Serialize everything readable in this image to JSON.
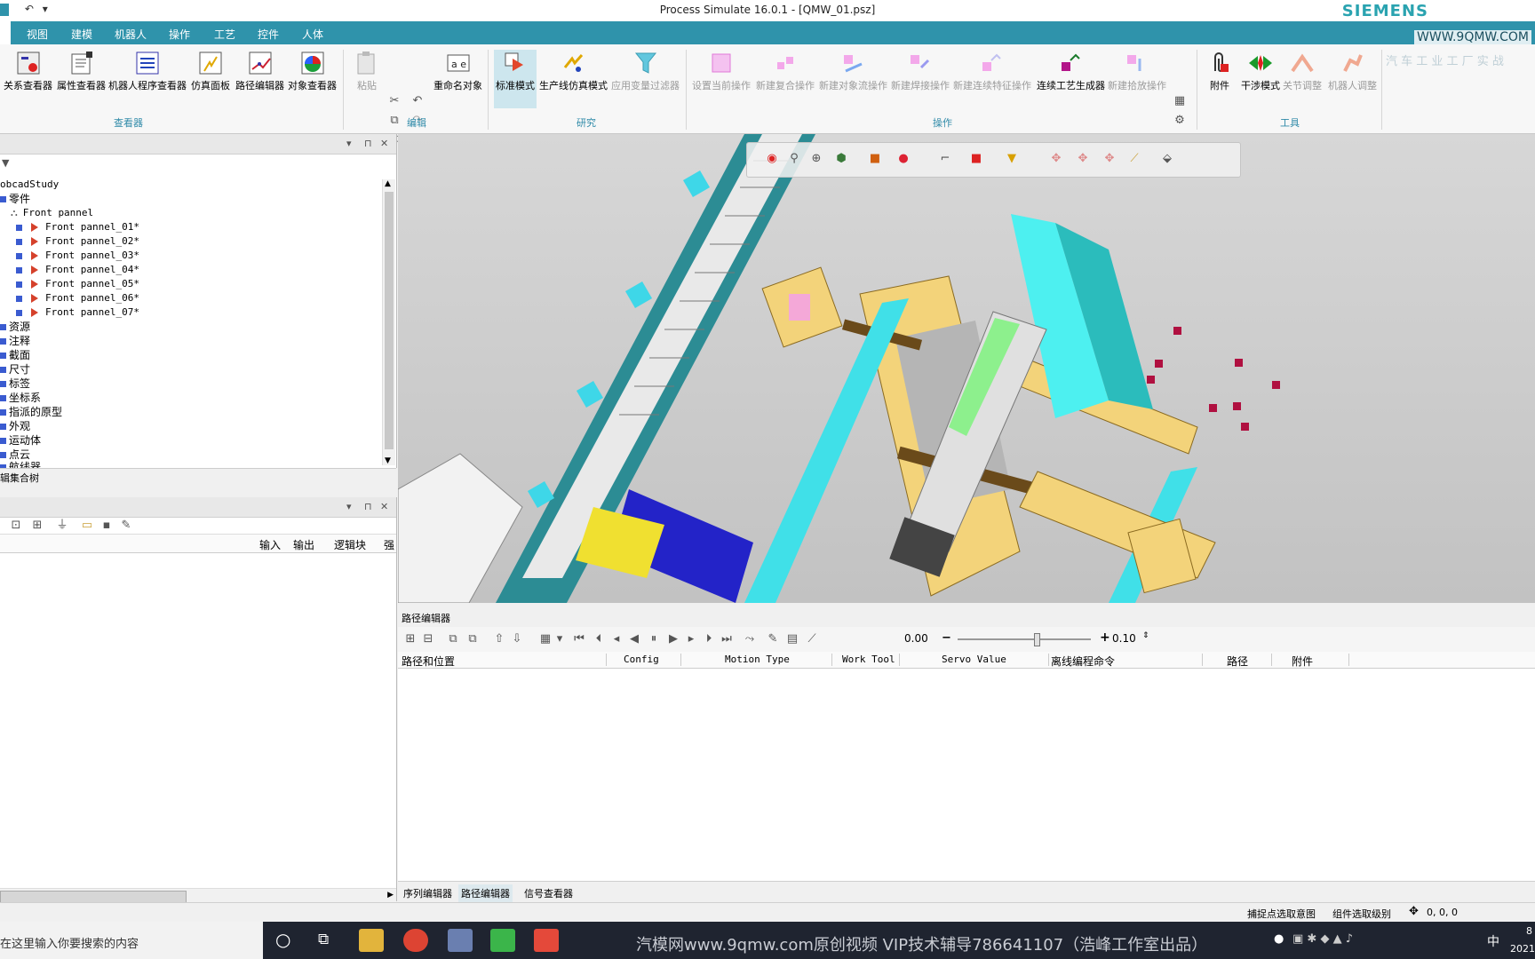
{
  "window": {
    "title": "Process Simulate 16.0.1 - [QMW_01.psz]",
    "brand": "SIEMENS",
    "brand_watermark": "WWW.9QMW.COM",
    "brand_sub": "汽 车 工 业 工 厂 实 战"
  },
  "quick_access": {
    "undo": "↶",
    "more": "▾"
  },
  "menu": [
    "视图",
    "建模",
    "机器人",
    "操作",
    "工艺",
    "控件",
    "人体"
  ],
  "ribbon": {
    "viewer": {
      "label": "查看器",
      "buttons": [
        "关系查看器",
        "属性查看器",
        "机器人程序查看器",
        "仿真面板",
        "路径编辑器",
        "对象查看器"
      ]
    },
    "edit": {
      "label": "编辑",
      "buttons": [
        "粘贴",
        "重命名对象"
      ]
    },
    "study": {
      "label": "研究",
      "buttons": [
        "标准模式",
        "生产线仿真模式",
        "应用变量过滤器"
      ]
    },
    "operation": {
      "label": "操作",
      "buttons": [
        "设置当前操作",
        "新建复合操作",
        "新建对象流操作",
        "新建焊接操作",
        "新建连续特征操作",
        "连续工艺生成器",
        "新建拾放操作"
      ]
    },
    "tools": {
      "label": "工具",
      "buttons": [
        "附件",
        "干涉模式",
        "关节调整",
        "机器人调整"
      ]
    }
  },
  "tree": {
    "root": "obcadStudy",
    "parts_folder": "零件",
    "assembly": "Front pannel",
    "children": [
      "Front pannel_01*",
      "Front pannel_02*",
      "Front pannel_03*",
      "Front pannel_04*",
      "Front pannel_05*",
      "Front pannel_06*",
      "Front pannel_07*"
    ],
    "folders": [
      "资源",
      "注释",
      "截面",
      "尺寸",
      "标签",
      "坐标系",
      "指派的原型",
      "外观",
      "运动体",
      "点云"
    ],
    "cut_item": "航线器",
    "tab_label": "辑集合树"
  },
  "signal_panel": {
    "columns": [
      "输入",
      "输出",
      "逻辑块",
      "强"
    ]
  },
  "path_editor": {
    "title": "路径编辑器",
    "time_value": "0.00",
    "minus": "−",
    "plus": "+",
    "step_value": "0.10",
    "columns": [
      "路径和位置",
      "Config",
      "Motion Type",
      "Work Tool",
      "Servo Value",
      "离线编程命令",
      "路径",
      "附件"
    ]
  },
  "bottom_tabs": [
    "序列编辑器",
    "路径编辑器",
    "信号查看器"
  ],
  "status": {
    "snap": "捕捉点选取意图",
    "pick_level": "组件选取级别",
    "coords": "0, 0, 0"
  },
  "taskbar": {
    "search_placeholder": "在这里输入你要搜索的内容",
    "watermark": "汽模网www.9qmw.com原创视频 VIP技术辅导786641107（浩峰工作室出品）",
    "ime": "中",
    "clock": "2021",
    "clock_top": "8"
  }
}
